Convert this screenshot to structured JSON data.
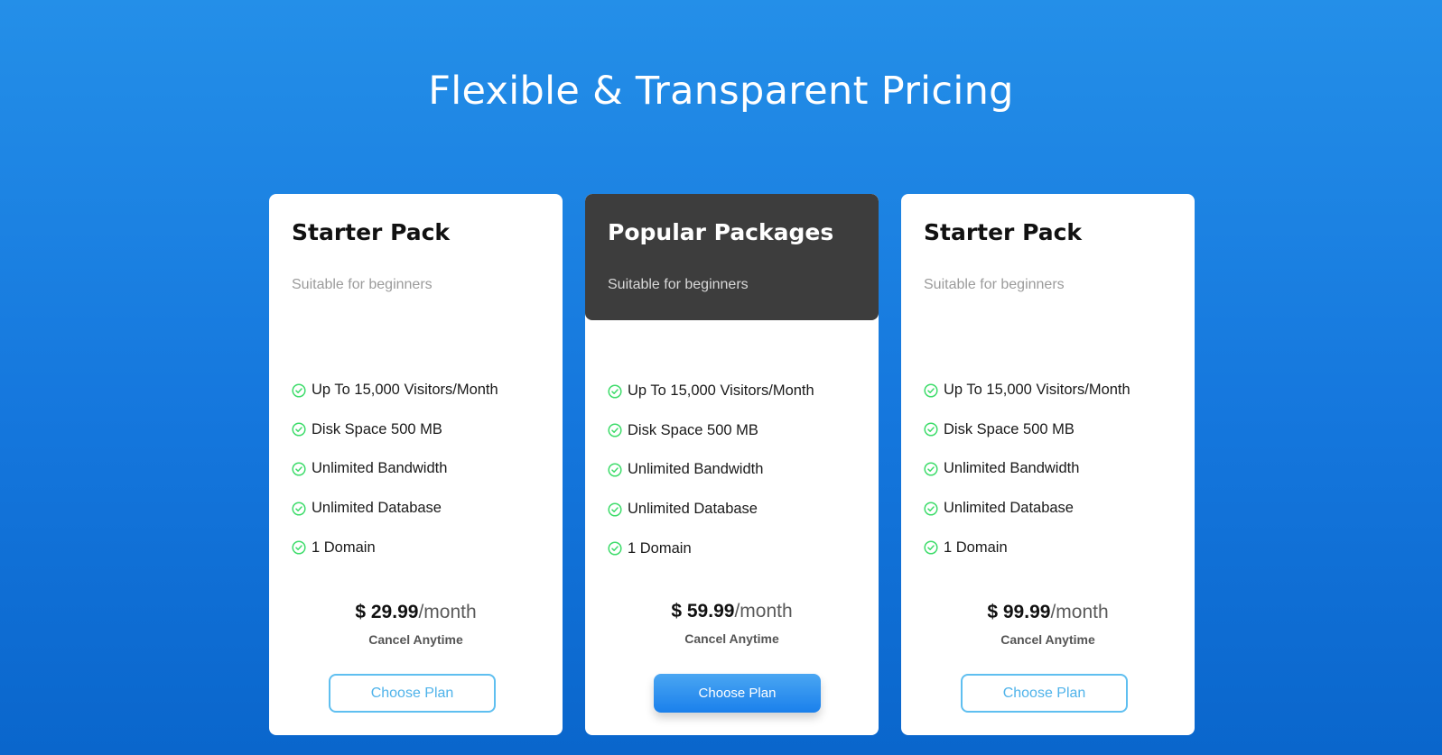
{
  "page": {
    "title": "Flexible & Transparent Pricing"
  },
  "plans": [
    {
      "name": "Starter Pack",
      "subtitle": "Suitable for beginners",
      "features": [
        "Up To 15,000 Visitors/Month",
        "Disk Space 500 MB",
        "Unlimited Bandwidth",
        "Unlimited Database",
        "1 Domain"
      ],
      "price": "$ 29.99",
      "period": "/month",
      "note": "Cancel Anytime",
      "button_label": "Choose Plan"
    },
    {
      "name": "Popular Packages",
      "subtitle": "Suitable for beginners",
      "features": [
        "Up To 15,000 Visitors/Month",
        "Disk Space 500 MB",
        "Unlimited Bandwidth",
        "Unlimited Database",
        "1 Domain"
      ],
      "price": "$ 59.99",
      "period": "/month",
      "note": "Cancel Anytime",
      "button_label": "Choose Plan"
    },
    {
      "name": "Starter Pack",
      "subtitle": "Suitable for beginners",
      "features": [
        "Up To 15,000 Visitors/Month",
        "Disk Space 500 MB",
        "Unlimited Bandwidth",
        "Unlimited Database",
        "1 Domain"
      ],
      "price": "$ 99.99",
      "period": "/month",
      "note": "Cancel Anytime",
      "button_label": "Choose Plan"
    }
  ],
  "icons": {
    "feature_check": "check-circle-icon"
  },
  "colors": {
    "background_top": "#248fe8",
    "background_bottom": "#0a66cc",
    "featured_header": "#3d3d3d",
    "check_green": "#3ddc6a",
    "button_outline": "#5fbff0",
    "button_primary": "#1a80ec"
  }
}
